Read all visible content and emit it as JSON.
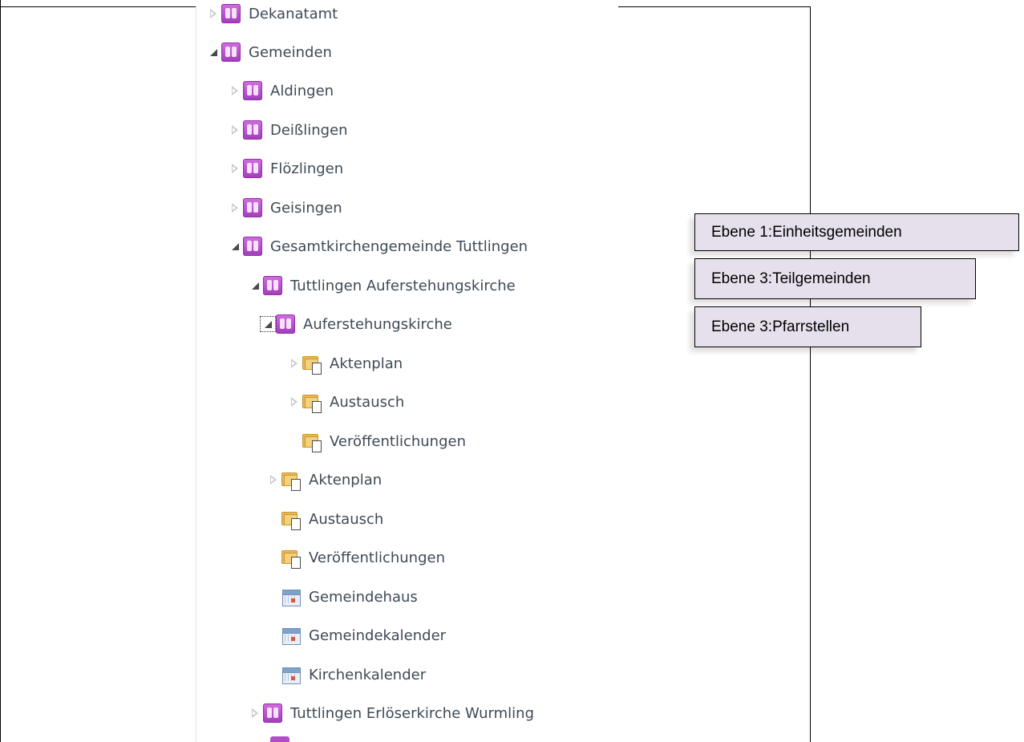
{
  "tree": {
    "items": [
      {
        "label": "Dekanatamt",
        "icon": "group-icon",
        "toggle": "collapsed"
      },
      {
        "label": "Gemeinden",
        "icon": "group-icon",
        "toggle": "expanded"
      },
      {
        "label": "Aldingen",
        "icon": "group-icon",
        "toggle": "collapsed"
      },
      {
        "label": "Deißlingen",
        "icon": "group-icon",
        "toggle": "collapsed"
      },
      {
        "label": "Flözlingen",
        "icon": "group-icon",
        "toggle": "collapsed"
      },
      {
        "label": "Geisingen",
        "icon": "group-icon",
        "toggle": "collapsed"
      },
      {
        "label": "Gesamtkirchengemeinde Tuttlingen",
        "icon": "group-icon",
        "toggle": "expanded"
      },
      {
        "label": "Tuttlingen Auferstehungskirche",
        "icon": "group-icon",
        "toggle": "expanded"
      },
      {
        "label": "Auferstehungskirche",
        "icon": "group-icon",
        "toggle": "expanded-focused"
      },
      {
        "label": "Aktenplan",
        "icon": "folder-document-icon",
        "toggle": "collapsed"
      },
      {
        "label": "Austausch",
        "icon": "folder-document-icon",
        "toggle": "collapsed"
      },
      {
        "label": "Veröffentlichungen",
        "icon": "folder-document-icon",
        "toggle": "none"
      },
      {
        "label": "Aktenplan",
        "icon": "folder-document-icon",
        "toggle": "collapsed"
      },
      {
        "label": "Austausch",
        "icon": "folder-document-icon",
        "toggle": "none"
      },
      {
        "label": "Veröffentlichungen",
        "icon": "folder-document-icon",
        "toggle": "none"
      },
      {
        "label": "Gemeindehaus",
        "icon": "calendar-icon",
        "toggle": "none"
      },
      {
        "label": "Gemeindekalender",
        "icon": "calendar-icon",
        "toggle": "none"
      },
      {
        "label": "Kirchenkalender",
        "icon": "calendar-icon",
        "toggle": "none"
      },
      {
        "label": "Tuttlingen Erlöserkirche Wurmling",
        "icon": "group-icon",
        "toggle": "collapsed"
      }
    ]
  },
  "callouts": {
    "level1": "Ebene 1:Einheitsgemeinden",
    "level3_parts": "Ebene 3:Teilgemeinden",
    "level3_parish": "Ebene 3:Pfarrstellen"
  },
  "colors": {
    "callout_fill": "#e6e0ec",
    "group_icon": "#b44cc9",
    "tree_text": "#3e4a56"
  }
}
